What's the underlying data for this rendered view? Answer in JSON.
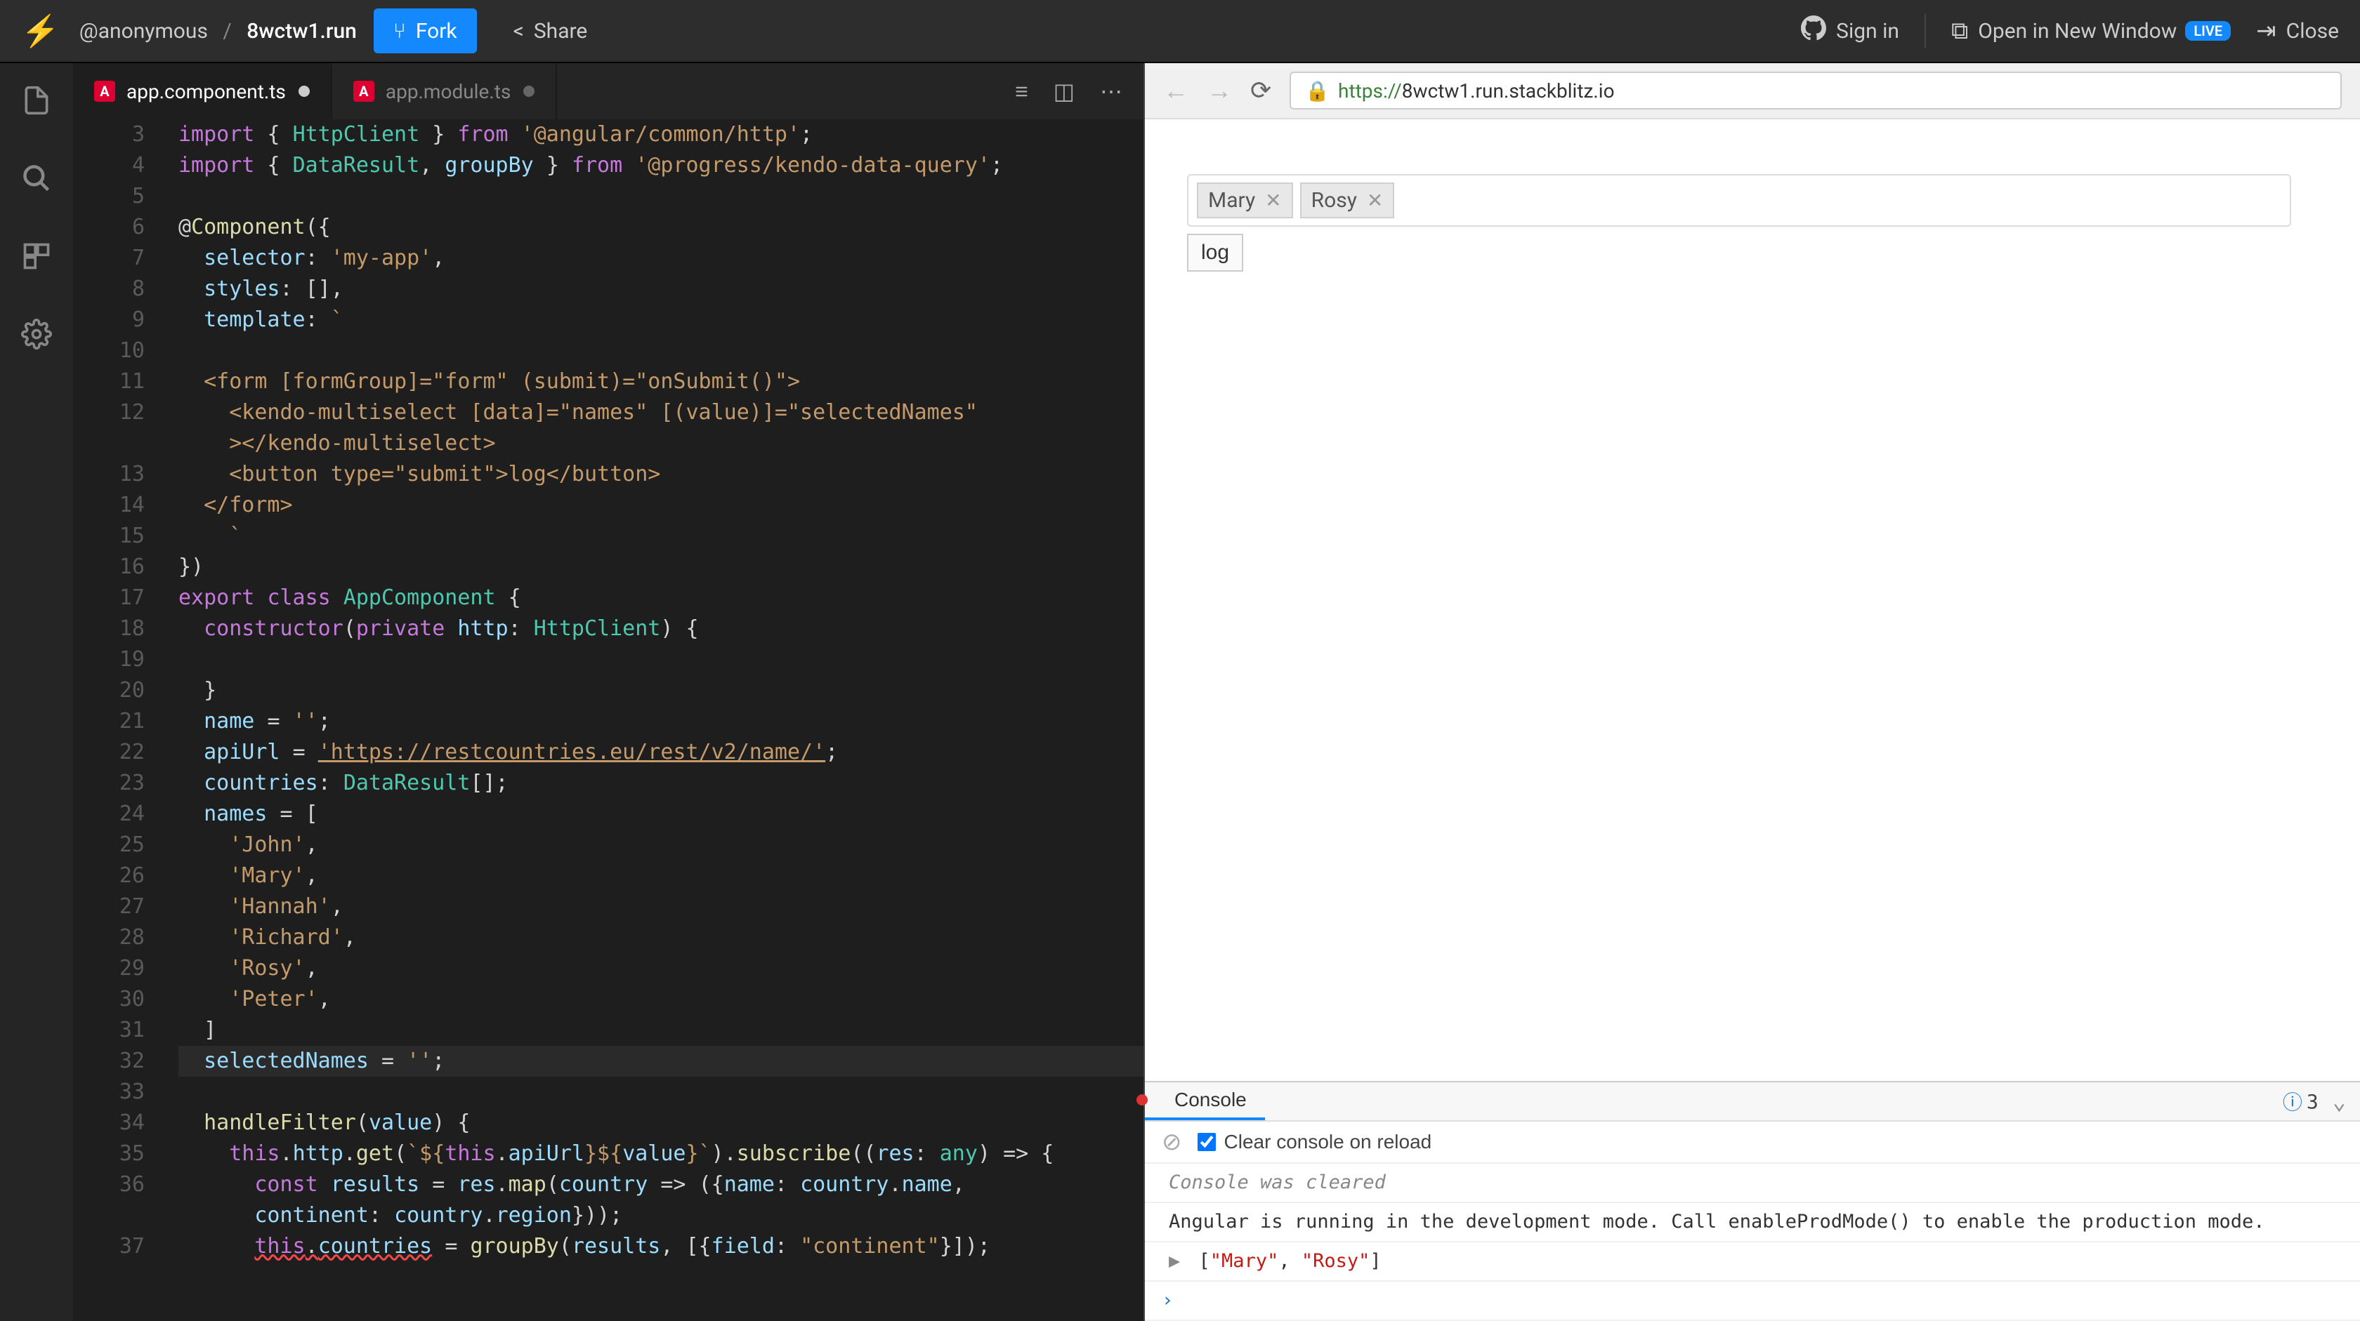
{
  "topbar": {
    "user": "@anonymous",
    "project": "8wctw1.run",
    "fork": "Fork",
    "share": "Share",
    "signin": "Sign in",
    "openNew": "Open in New Window",
    "live": "LIVE",
    "close": "Close"
  },
  "tabs": [
    {
      "name": "app.component.ts",
      "active": true,
      "dirty": true
    },
    {
      "name": "app.module.ts",
      "active": false,
      "dirty": true
    }
  ],
  "code": {
    "startLine": 3,
    "lines": [
      {
        "n": 3,
        "html": "<span class='kw'>import</span> <span class='punct'>{</span> <span class='type'>HttpClient</span> <span class='punct'>}</span> <span class='kw'>from</span> <span class='str'>'@angular/common/http'</span><span class='punct'>;</span>"
      },
      {
        "n": 4,
        "html": "<span class='kw'>import</span> <span class='punct'>{</span> <span class='type'>DataResult</span><span class='punct'>,</span> <span class='var'>groupBy</span> <span class='punct'>}</span> <span class='kw'>from</span> <span class='str'>'@progress/kendo-data-query'</span><span class='punct'>;</span>"
      },
      {
        "n": 5,
        "html": ""
      },
      {
        "n": 6,
        "html": "<span class='punct'>@</span><span class='fn'>Component</span><span class='punct'>({</span>"
      },
      {
        "n": 7,
        "html": "  <span class='prop'>selector</span><span class='punct'>:</span> <span class='str'>'my-app'</span><span class='punct'>,</span>"
      },
      {
        "n": 8,
        "html": "  <span class='prop'>styles</span><span class='punct'>:</span> <span class='punct'>[]</span><span class='punct'>,</span>"
      },
      {
        "n": 9,
        "html": "  <span class='prop'>template</span><span class='punct'>:</span> <span class='str'>`</span>"
      },
      {
        "n": 10,
        "html": ""
      },
      {
        "n": 11,
        "html": "  <span class='str'>&lt;form [formGroup]=&quot;form&quot; (submit)=&quot;onSubmit()&quot;&gt;</span>"
      },
      {
        "n": 12,
        "html": "    <span class='str'>&lt;kendo-multiselect [data]=&quot;names&quot; [(value)]=&quot;selectedNames&quot;</span>\n    <span class='str'>&gt;&lt;/kendo-multiselect&gt;</span>",
        "wrap": true
      },
      {
        "n": 13,
        "html": "    <span class='str'>&lt;button type=&quot;submit&quot;&gt;log&lt;/button&gt;</span>"
      },
      {
        "n": 14,
        "html": "  <span class='str'>&lt;/form&gt;</span>"
      },
      {
        "n": 15,
        "html": "    <span class='str'>`</span>"
      },
      {
        "n": 16,
        "html": "<span class='punct'>})</span>"
      },
      {
        "n": 17,
        "html": "<span class='kw'>export</span> <span class='kw'>class</span> <span class='type'>AppComponent</span> <span class='punct'>{</span>"
      },
      {
        "n": 18,
        "html": "  <span class='kw'>constructor</span><span class='punct'>(</span><span class='kw'>private</span> <span class='var'>http</span><span class='punct'>:</span> <span class='type'>HttpClient</span><span class='punct'>)</span> <span class='punct'>{</span>"
      },
      {
        "n": 19,
        "html": ""
      },
      {
        "n": 20,
        "html": "  <span class='punct'>}</span>"
      },
      {
        "n": 21,
        "html": "  <span class='var'>name</span> <span class='op'>=</span> <span class='str'>''</span><span class='punct'>;</span>"
      },
      {
        "n": 22,
        "html": "  <span class='var'>apiUrl</span> <span class='op'>=</span> <span class='str ul'>'https://restcountries.eu/rest/v2/name/'</span><span class='punct'>;</span>"
      },
      {
        "n": 23,
        "html": "  <span class='var'>countries</span><span class='punct'>:</span> <span class='type'>DataResult</span><span class='punct'>[];</span>"
      },
      {
        "n": 24,
        "html": "  <span class='var'>names</span> <span class='op'>=</span> <span class='punct'>[</span>"
      },
      {
        "n": 25,
        "html": "    <span class='str'>'John'</span><span class='punct'>,</span>"
      },
      {
        "n": 26,
        "html": "    <span class='str'>'Mary'</span><span class='punct'>,</span>"
      },
      {
        "n": 27,
        "html": "    <span class='str'>'Hannah'</span><span class='punct'>,</span>"
      },
      {
        "n": 28,
        "html": "    <span class='str'>'Richard'</span><span class='punct'>,</span>"
      },
      {
        "n": 29,
        "html": "    <span class='str'>'Rosy'</span><span class='punct'>,</span>"
      },
      {
        "n": 30,
        "html": "    <span class='str'>'Peter'</span><span class='punct'>,</span>"
      },
      {
        "n": 31,
        "html": "  <span class='punct'>]</span>"
      },
      {
        "n": 32,
        "html": "  <span class='var'>selectedNames</span> <span class='op'>=</span> <span class='str'>''</span><span class='punct'>;</span>",
        "hl": true
      },
      {
        "n": 33,
        "html": ""
      },
      {
        "n": 34,
        "html": "  <span class='fn'>handleFilter</span><span class='punct'>(</span><span class='param'>value</span><span class='punct'>)</span> <span class='punct'>{</span>"
      },
      {
        "n": 35,
        "html": "    <span class='kw'>this</span><span class='punct'>.</span><span class='var'>http</span><span class='punct'>.</span><span class='fn'>get</span><span class='punct'>(</span><span class='str'>`${</span><span class='kw'>this</span><span class='punct'>.</span><span class='var'>apiUrl</span><span class='str'>}${</span><span class='var'>value</span><span class='str'>}`</span><span class='punct'>).</span><span class='fn'>subscribe</span><span class='punct'>((</span><span class='param'>res</span><span class='punct'>:</span> <span class='type'>any</span><span class='punct'>)</span> <span class='op'>=&gt;</span> <span class='punct'>{</span>"
      },
      {
        "n": 36,
        "html": "      <span class='kw'>const</span> <span class='var'>results</span> <span class='op'>=</span> <span class='var'>res</span><span class='punct'>.</span><span class='fn'>map</span><span class='punct'>(</span><span class='param'>country</span> <span class='op'>=&gt;</span> <span class='punct'>({</span><span class='prop'>name</span><span class='punct'>:</span> <span class='var'>country</span><span class='punct'>.</span><span class='var'>name</span><span class='punct'>,</span>\n      <span class='prop'>continent</span><span class='punct'>:</span> <span class='var'>country</span><span class='punct'>.</span><span class='var'>region</span><span class='punct'>}));</span>",
        "wrap": true
      },
      {
        "n": 37,
        "html": "      <span class='kw err'>this</span><span class='punct err'>.</span><span class='var err'>countries</span> <span class='op'>=</span> <span class='fn'>groupBy</span><span class='punct'>(</span><span class='var'>results</span><span class='punct'>,</span> <span class='punct'>[{</span><span class='prop'>field</span><span class='punct'>:</span> <span class='str'>&quot;continent&quot;</span><span class='punct'>}]);</span>"
      }
    ]
  },
  "preview": {
    "url_proto": "https://",
    "url_rest": "8wctw1.run.stackblitz.io",
    "chips": [
      "Mary",
      "Rosy"
    ],
    "button": "log"
  },
  "console": {
    "tab": "Console",
    "infoCount": "3",
    "clearLabel": "Clear console on reload",
    "lines": {
      "cleared": "Console was cleared",
      "devmode": "Angular is running in the development mode. Call enableProdMode() to enable the production mode.",
      "array_open": "[",
      "array_items": [
        "\"Mary\"",
        "\"Rosy\""
      ],
      "array_close": "]"
    }
  }
}
